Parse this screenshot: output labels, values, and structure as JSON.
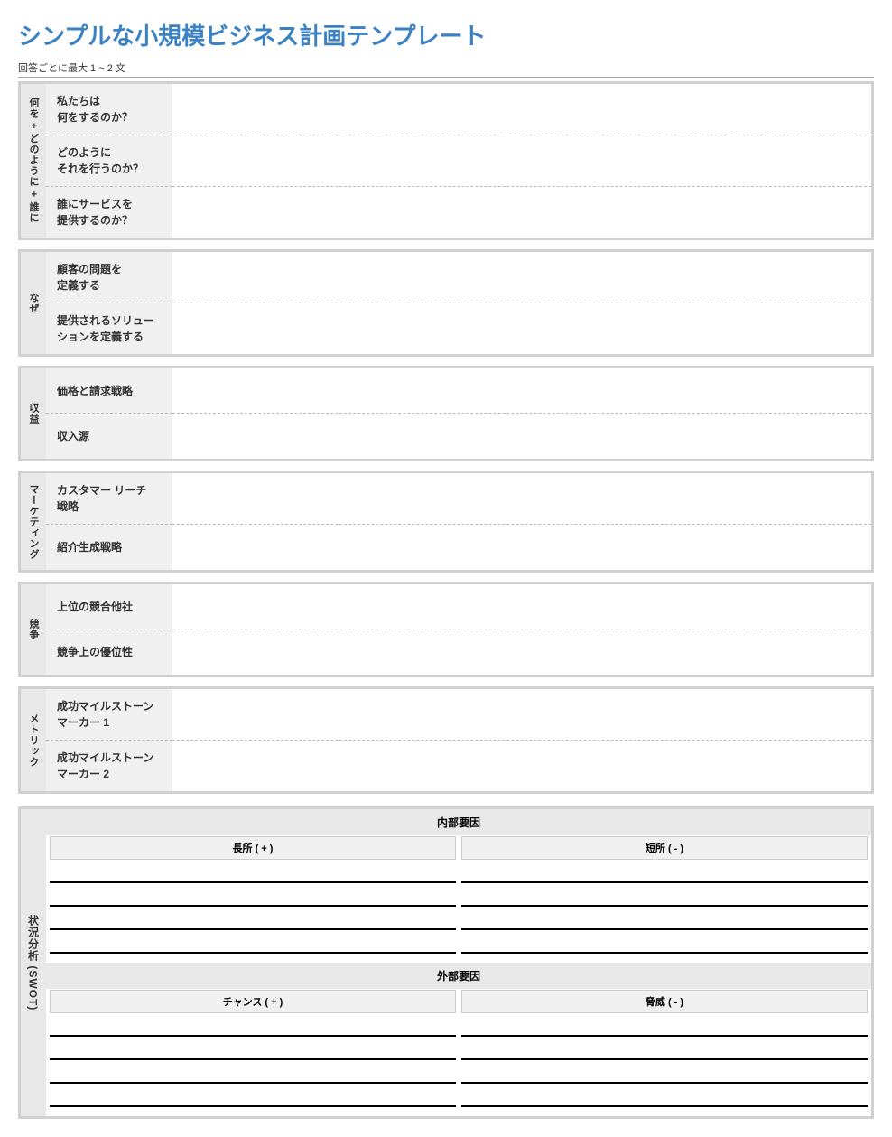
{
  "title": "シンプルな小規模ビジネス計画テンプレート",
  "subtitle": "回答ごとに最大 1 ~ 2 文",
  "sections": [
    {
      "vertical_label": "何を + どのように + 誰に",
      "rows": [
        {
          "label": "私たちは\n何をするのか？",
          "content": ""
        },
        {
          "label": "どのように\nそれを行うのか？",
          "content": ""
        },
        {
          "label": "誰にサービスを\n提供するのか？",
          "content": ""
        }
      ]
    },
    {
      "vertical_label": "なぜ",
      "rows": [
        {
          "label": "顧客の問題を\n定義する",
          "content": ""
        },
        {
          "label": "提供されるソリューションを定義する",
          "content": ""
        }
      ]
    },
    {
      "vertical_label": "収益",
      "rows": [
        {
          "label": "価格と請求戦略",
          "content": ""
        },
        {
          "label": "収入源",
          "content": ""
        }
      ]
    },
    {
      "vertical_label": "マーケティング",
      "rows": [
        {
          "label": "カスタマー リーチ\n戦略",
          "content": ""
        },
        {
          "label": "紹介生成戦略",
          "content": ""
        }
      ]
    },
    {
      "vertical_label": "競争",
      "rows": [
        {
          "label": "上位の競合他社",
          "content": ""
        },
        {
          "label": "競争上の優位性",
          "content": ""
        }
      ]
    },
    {
      "vertical_label": "メトリック",
      "rows": [
        {
          "label": "成功マイルストーン\nマーカー 1",
          "content": ""
        },
        {
          "label": "成功マイルストーン\nマーカー 2",
          "content": ""
        }
      ]
    }
  ],
  "swot": {
    "vertical_label": "状況分析 (SWOT)",
    "internal_header": "内部要因",
    "external_header": "外部要因",
    "strengths_label": "長所 ( + )",
    "weaknesses_label": "短所 ( - )",
    "opportunities_label": "チャンス ( + )",
    "threats_label": "脅威 ( - )",
    "strengths": [
      "",
      "",
      "",
      ""
    ],
    "weaknesses": [
      "",
      "",
      "",
      ""
    ],
    "opportunities": [
      "",
      "",
      "",
      ""
    ],
    "threats": [
      "",
      "",
      "",
      ""
    ]
  }
}
